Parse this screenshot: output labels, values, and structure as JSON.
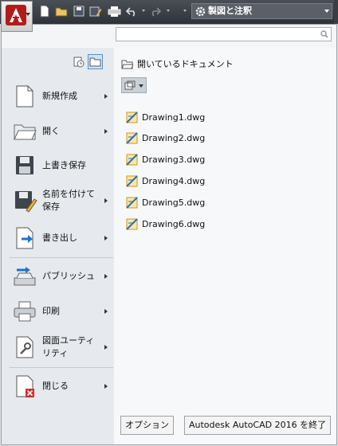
{
  "workspace": {
    "label": "製図と注釈"
  },
  "search": {
    "value": "",
    "placeholder": ""
  },
  "menu": {
    "items": [
      {
        "label": "新規作成"
      },
      {
        "label": "開く"
      },
      {
        "label": "上書き保存"
      },
      {
        "label": "名前を付けて保存"
      },
      {
        "label": "書き出し"
      },
      {
        "label": "パブリッシュ"
      },
      {
        "label": "印刷"
      },
      {
        "label": "図面ユーティリティ"
      },
      {
        "label": "閉じる"
      }
    ]
  },
  "right": {
    "heading": "開いているドキュメント",
    "documents": [
      "Drawing1.dwg",
      "Drawing2.dwg",
      "Drawing3.dwg",
      "Drawing4.dwg",
      "Drawing5.dwg",
      "Drawing6.dwg"
    ]
  },
  "footer": {
    "options_label": "オプション",
    "exit_label": "Autodesk AutoCAD 2016 を終了"
  },
  "colors": {
    "accent": "#b31b1b",
    "toolbar": "#3a3e44",
    "selection": "#cfe2f5"
  }
}
